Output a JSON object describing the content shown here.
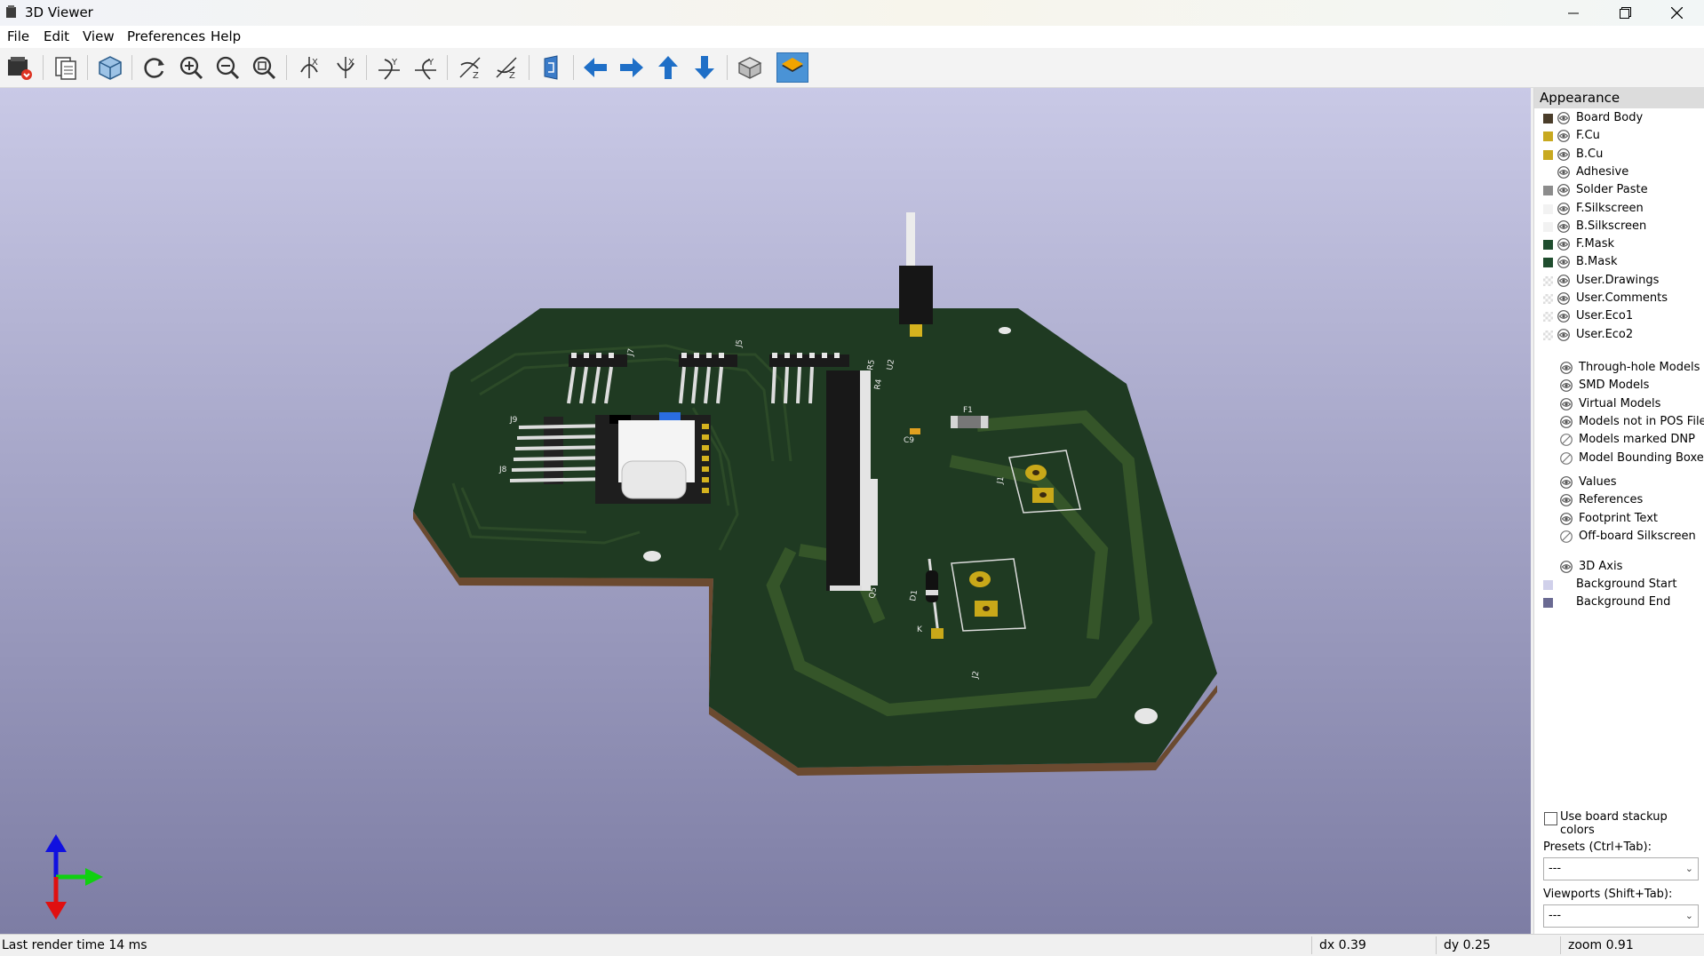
{
  "window": {
    "title": "3D Viewer"
  },
  "menu": [
    "File",
    "Edit",
    "View",
    "Preferences",
    "Help"
  ],
  "toolbar": {
    "buttons": [
      "render-raytraced-icon",
      "copy-image-icon",
      "board-view-icon",
      "reload-icon",
      "zoom-in-icon",
      "zoom-out-icon",
      "zoom-fit-icon",
      "rotate-x-cw-icon",
      "rotate-x-ccw-icon",
      "rotate-y-cw-icon",
      "rotate-y-ccw-icon",
      "rotate-z-cw-icon",
      "rotate-z-ccw-icon",
      "flip-board-icon",
      "move-left-icon",
      "move-right-icon",
      "move-up-icon",
      "move-down-icon",
      "orthographic-icon",
      "show-layers-icon"
    ],
    "active": "show-layers-icon"
  },
  "appearance": {
    "title": "Appearance",
    "layers": [
      {
        "name": "Board Body",
        "color": "#4a3d2a",
        "visible": true
      },
      {
        "name": "F.Cu",
        "color": "#c8a920",
        "visible": true
      },
      {
        "name": "B.Cu",
        "color": "#c8a920",
        "visible": true
      },
      {
        "name": "Adhesive",
        "color": "",
        "visible": true
      },
      {
        "name": "Solder Paste",
        "color": "#8c8c8c",
        "visible": true
      },
      {
        "name": "F.Silkscreen",
        "color": "#f2f2f2",
        "visible": true
      },
      {
        "name": "B.Silkscreen",
        "color": "#f2f2f2",
        "visible": true
      },
      {
        "name": "F.Mask",
        "color": "#1f4d2e",
        "visible": true
      },
      {
        "name": "B.Mask",
        "color": "#1f4d2e",
        "visible": true
      },
      {
        "name": "User.Drawings",
        "color": "checker",
        "visible": true
      },
      {
        "name": "User.Comments",
        "color": "checker",
        "visible": true
      },
      {
        "name": "User.Eco1",
        "color": "checker",
        "visible": true
      },
      {
        "name": "User.Eco2",
        "color": "checker",
        "visible": true
      }
    ],
    "models": [
      {
        "name": "Through-hole Models",
        "visible": true
      },
      {
        "name": "SMD Models",
        "visible": true
      },
      {
        "name": "Virtual Models",
        "visible": true
      },
      {
        "name": "Models not in POS File",
        "visible": true
      },
      {
        "name": "Models marked DNP",
        "visible": false
      },
      {
        "name": "Model Bounding Boxes",
        "visible": false
      }
    ],
    "texts": [
      {
        "name": "Values",
        "visible": true
      },
      {
        "name": "References",
        "visible": true
      },
      {
        "name": "Footprint Text",
        "visible": true
      },
      {
        "name": "Off-board Silkscreen",
        "visible": false
      }
    ],
    "axis": {
      "name": "3D Axis",
      "visible": true
    },
    "background": [
      {
        "name": "Background Start",
        "color": "#d0d0ea"
      },
      {
        "name": "Background End",
        "color": "#6a6a92"
      }
    ],
    "use_stackup_colors": "Use board stackup colors",
    "presets_label": "Presets (Ctrl+Tab):",
    "presets_value": "---",
    "viewports_label": "Viewports (Shift+Tab):",
    "viewports_value": "---"
  },
  "pcb": {
    "refs": [
      "J9",
      "J8",
      "J7",
      "J5",
      "C9",
      "F1",
      "J1",
      "D1",
      "K",
      "J2",
      "Q5",
      "U2",
      "R5",
      "R4"
    ],
    "colors": {
      "mask": "#1f3a22",
      "copper": "#c9a819",
      "edge": "#6b4a30"
    }
  },
  "status": {
    "render_time": "Last render time 14 ms",
    "dx": "dx 0.39",
    "dy": "dy 0.25",
    "zoom": "zoom 0.91"
  }
}
